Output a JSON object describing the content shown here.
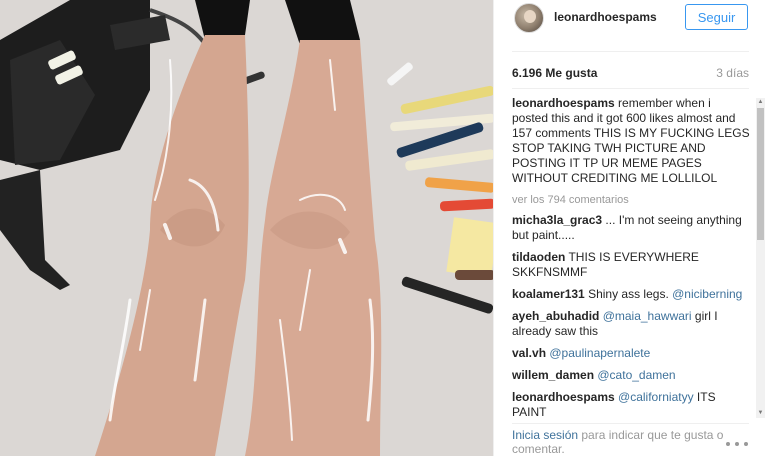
{
  "post": {
    "username": "leonardhoespams",
    "follow_label": "Seguir",
    "likes": "6.196 Me gusta",
    "time": "3 días"
  },
  "comments": {
    "caption": {
      "user": "leonardhoespams",
      "text": " remember when i posted this and it got 600 likes almost and 157 comments THIS IS MY FUCKING LEGS STOP TAKING TWH PICTURE AND POSTING IT TP UR MEME PAGES WITHOUT CREDITING ME LOLLILOL"
    },
    "view_all": "ver los 794 comentarios",
    "items": [
      {
        "user": "micha3la_grac3",
        "text": " ... I'm not seeing anything but paint.....",
        "mention": ""
      },
      {
        "user": "tildaoden",
        "text": " THIS IS EVERYWHERE SKKFNSMMF",
        "mention": ""
      },
      {
        "user": "koalamer131",
        "text": " Shiny ass legs. ",
        "mention": "@niciberning"
      },
      {
        "user": "ayeh_abuhadid",
        "text": " girl I already saw this",
        "mention": " @maia_hawwari"
      },
      {
        "user": "val.vh",
        "text": " ",
        "mention": "@paulinapernalete"
      },
      {
        "user": "willem_damen",
        "text": " ",
        "mention": "@cato_damen"
      },
      {
        "user": "leonardhoespams",
        "text": " ITS PAINT",
        "mention": " @californiatyy"
      }
    ]
  },
  "footer": {
    "login_link": "Inicia sesión",
    "login_rest": " para indicar que te gusta o comentar."
  },
  "icons": {
    "more": "more-options-icon",
    "scroll_up": "scroll-up-arrow-icon",
    "scroll_down": "scroll-down-arrow-icon"
  },
  "colors": {
    "link": "#3f729b",
    "follow": "#3897f0",
    "muted": "#999999"
  }
}
